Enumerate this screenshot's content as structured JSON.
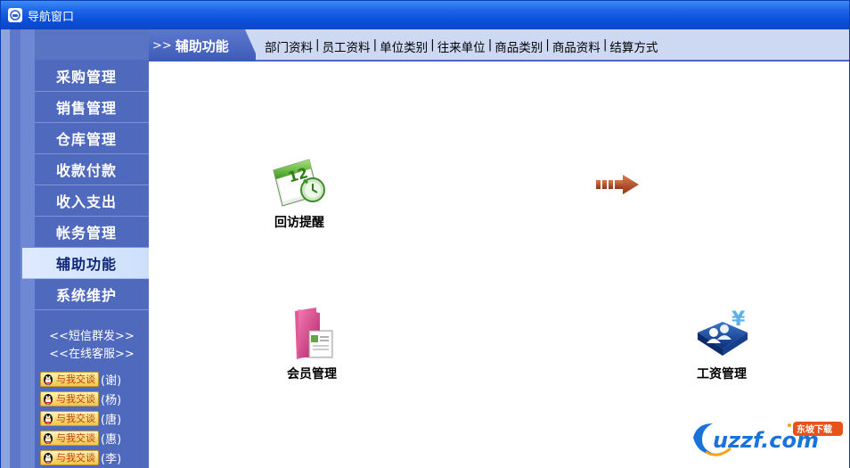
{
  "window": {
    "title": "导航窗口"
  },
  "sidebar": {
    "items": [
      {
        "label": "采购管理"
      },
      {
        "label": "销售管理"
      },
      {
        "label": "仓库管理"
      },
      {
        "label": "收款付款"
      },
      {
        "label": "收入支出"
      },
      {
        "label": "帐务管理"
      },
      {
        "label": "辅助功能",
        "active": true
      },
      {
        "label": "系统维护"
      }
    ],
    "service_links": [
      "<<短信群发>>",
      "<<在线客服>>"
    ],
    "qq_contacts": [
      {
        "badge": "与我交谈",
        "name": "(谢)"
      },
      {
        "badge": "与我交谈",
        "name": "(杨)"
      },
      {
        "badge": "与我交谈",
        "name": "(唐)"
      },
      {
        "badge": "与我交谈",
        "name": "(惠)"
      },
      {
        "badge": "与我交谈",
        "name": "(李)"
      }
    ]
  },
  "tabbar": {
    "arrows": ">>",
    "title": "辅助功能",
    "links": [
      "部门资料",
      "员工资料",
      "单位类别",
      "往来单位",
      "商品类别",
      "商品资料",
      "结算方式"
    ],
    "separator": "|"
  },
  "modules": {
    "revisit": {
      "label": "回访提醒",
      "icon": "calendar-12-icon"
    },
    "member": {
      "label": "会员管理",
      "icon": "pink-folder-icon"
    },
    "salary": {
      "label": "工资管理",
      "icon": "users-yen-icon"
    },
    "flow_arrow": {
      "icon": "flow-arrow-icon"
    }
  },
  "watermark": {
    "text": "uzzf.com",
    "badge": "东坡下载"
  },
  "colors": {
    "titlebar": "#0a4fd8",
    "sidebar": "#4f69bd",
    "active_item": "#dfeaff",
    "tabbar": "#cdd9f3",
    "arrow": "#b34a23"
  }
}
